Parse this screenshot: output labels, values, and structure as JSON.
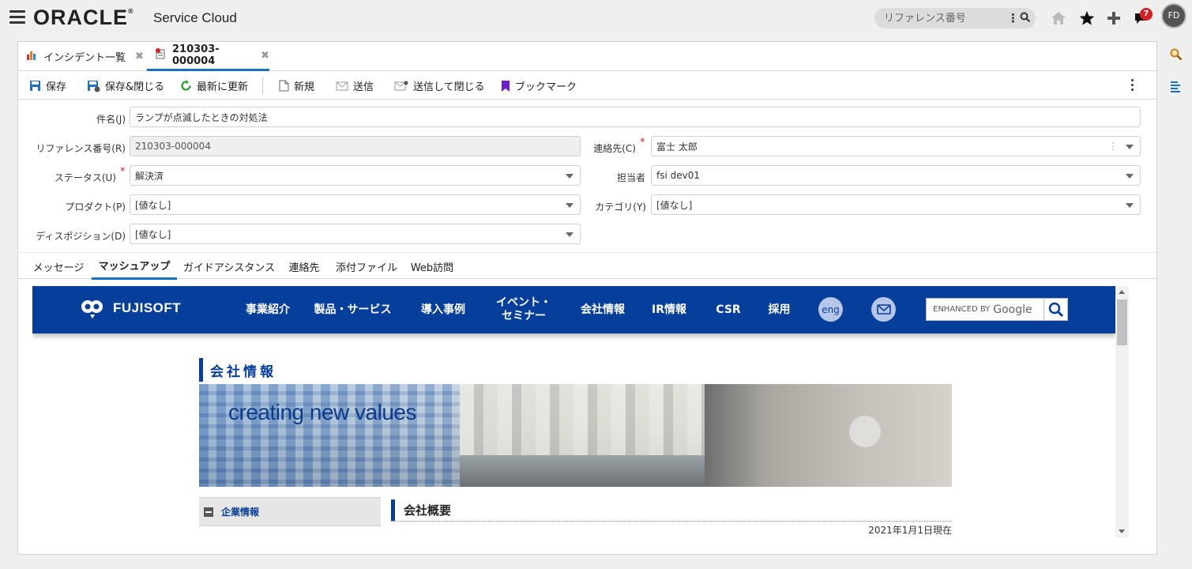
{
  "header": {
    "brand": "ORACLE",
    "product": "Service Cloud",
    "search_placeholder": "リファレンス番号",
    "notification_count": "7",
    "avatar_initials": "FD",
    "icons": [
      "menu-icon",
      "more-vertical-icon",
      "search-icon",
      "home-icon",
      "star-icon",
      "plus-icon",
      "notification-icon"
    ]
  },
  "tabs": [
    {
      "label": "インシデント一覧",
      "icon": "chart-icon",
      "active": false
    },
    {
      "label": "210303-000004",
      "icon": "incident-icon",
      "active": true
    }
  ],
  "toolbar": {
    "save": "保存",
    "save_close": "保存&閉じる",
    "refresh": "最新に更新",
    "new": "新規",
    "send": "送信",
    "send_close": "送信して閉じる",
    "bookmark": "ブックマーク"
  },
  "form": {
    "subject_label": "件名(J)",
    "subject_value": "ランプが点滅したときの対処法",
    "reference_label": "リファレンス番号(R)",
    "reference_value": "210303-000004",
    "contact_label": "連絡先(C)",
    "contact_value": "富士 太郎",
    "status_label": "ステータス(U)",
    "status_value": "解決済",
    "assigned_label": "担当者",
    "assigned_value": "fsi dev01",
    "product_label": "プロダクト(P)",
    "product_value": "[値なし]",
    "category_label": "カテゴリ(Y)",
    "category_value": "[値なし]",
    "disposition_label": "ディスポジション(D)",
    "disposition_value": "[値なし]",
    "required_mark": "*"
  },
  "subtabs": [
    "メッセージ",
    "マッシュアップ",
    "ガイドアシスタンス",
    "連絡先",
    "添付ファイル",
    "Web訪問"
  ],
  "subtab_active": "マッシュアップ",
  "website": {
    "logo_text": "FUJISOFT",
    "nav": [
      "事業紹介",
      "製品・サービス",
      "導入事例",
      "イベント・\nセミナー",
      "会社情報",
      "IR情報",
      "CSR",
      "採用"
    ],
    "eng": "eng",
    "search_prefix": "ENHANCED BY",
    "search_brand": "Google",
    "page_title": "会社情報",
    "hero_text": "creating new values",
    "side_menu": "企業情報",
    "section_title": "会社概要",
    "section_date": "2021年1月1日現在",
    "colors": {
      "nav_bg": "#063f9b",
      "accent": "#1b6fc4"
    }
  }
}
